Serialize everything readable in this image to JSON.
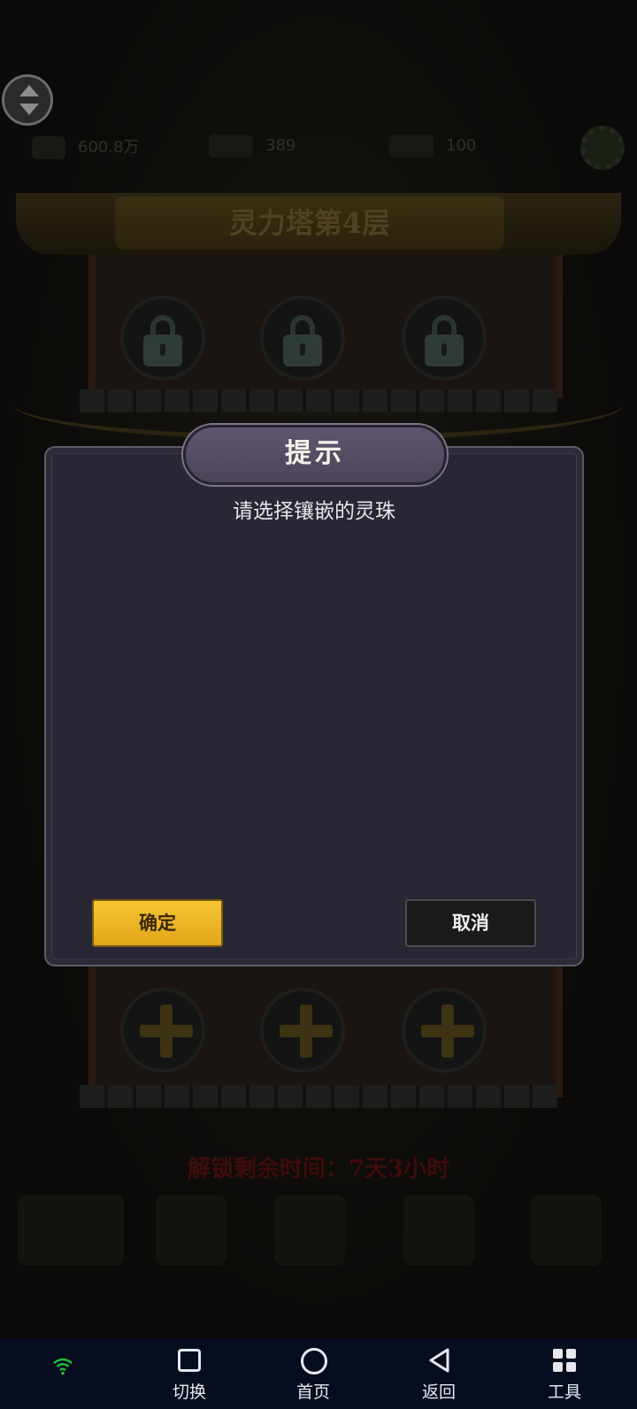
{
  "background_game": {
    "tower_title": "灵力塔第4层",
    "resources": [
      "600.8万",
      "389",
      "100"
    ],
    "unlock_text": "解锁剩余时间：7天3小时"
  },
  "dialog": {
    "title": "提示",
    "message": "请选择镶嵌的灵珠",
    "confirm_label": "确定",
    "cancel_label": "取消"
  },
  "navbar": {
    "switch_label": "切换",
    "home_label": "首页",
    "back_label": "返回",
    "tools_label": "工具"
  },
  "colors": {
    "dialog_bg": "#282733",
    "title_bg": "#5a5168",
    "confirm_bg": "#f0b82a",
    "navbar_bg": "#060d1f",
    "wifi": "#1fbf3a"
  },
  "icons": [
    "scroll-toggle-icon",
    "settings-gear-icon",
    "lock-icon",
    "plus-icon",
    "wifi-icon",
    "switch-icon",
    "home-icon",
    "back-icon",
    "tools-icon"
  ]
}
